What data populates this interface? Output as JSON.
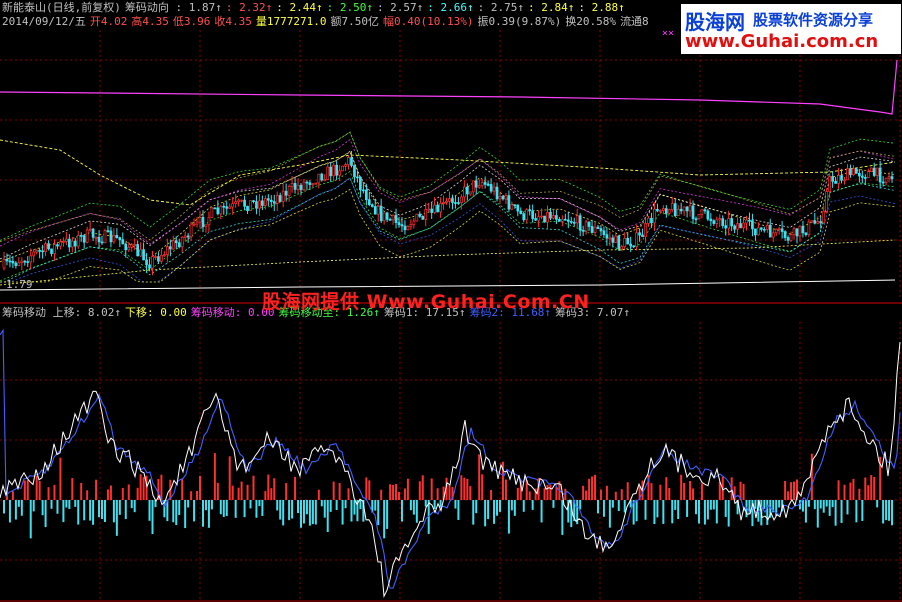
{
  "header": {
    "row1": [
      {
        "text": "新能泰山(日线,前复权)",
        "color": "#c0c0c0"
      },
      {
        "text": "筹码动向 : 1.87↑",
        "color": "#c0c0c0"
      },
      {
        "text": ": 2.32↑",
        "color": "#ff5050"
      },
      {
        "text": ": 2.44↑",
        "color": "#ffff40"
      },
      {
        "text": ": 2.50↑",
        "color": "#40ff40"
      },
      {
        "text": ": 2.57↑",
        "color": "#c0c0c0"
      },
      {
        "text": ": 2.66↑",
        "color": "#40ffff"
      },
      {
        "text": ": 2.75↑",
        "color": "#c0c0c0"
      },
      {
        "text": ": 2.84↑",
        "color": "#ffff40"
      },
      {
        "text": ": 2.88↑",
        "color": "#ffff40"
      }
    ],
    "row2": [
      {
        "text": "2014/09/12/五",
        "color": "#c0c0c0"
      },
      {
        "text": "开4.02",
        "color": "#ff5050"
      },
      {
        "text": "高4.35",
        "color": "#ff5050"
      },
      {
        "text": "低3.96",
        "color": "#ff5050"
      },
      {
        "text": "收4.35",
        "color": "#ff5050"
      },
      {
        "text": "量1777271.0",
        "color": "#ffff40"
      },
      {
        "text": "额7.50亿",
        "color": "#c0c0c0"
      },
      {
        "text": "幅0.40(10.13%)",
        "color": "#ff5050"
      },
      {
        "text": "振0.39(9.87%)",
        "color": "#c0c0c0"
      },
      {
        "text": "换20.58%",
        "color": "#c0c0c0"
      },
      {
        "text": "流通8",
        "color": "#c0c0c0"
      }
    ],
    "row3": [
      {
        "text": "筹码移动 上移: 8.02↑",
        "color": "#c0c0c0"
      },
      {
        "text": "下移: 0.00",
        "color": "#ffff40"
      },
      {
        "text": "筹码移动: 0.00",
        "color": "#ff40ff"
      },
      {
        "text": "筹码移动至: 1.26↑",
        "color": "#40ff40"
      },
      {
        "text": "筹码1: 17.15↑",
        "color": "#c0c0c0"
      },
      {
        "text": "筹码2: 11.68↑",
        "color": "#4060ff"
      },
      {
        "text": "筹码3: 7.07↑",
        "color": "#c0c0c0"
      }
    ]
  },
  "watermark_center": "股海网提供 Www.Guhai.Com.CN",
  "logo": {
    "brand": "股海网",
    "tagline": "股票软件资源分享",
    "url": "www.Guhai.com.cn"
  },
  "min_label": "1.79",
  "x_mark": "××",
  "colors": {
    "up": "#ff3030",
    "down": "#40e0f0",
    "grid": "#8a0000",
    "divider": "#b00000"
  },
  "chart_data": [
    {
      "type": "line",
      "panel": "price",
      "title": "",
      "series_count": 9,
      "min_label": 1.79,
      "legend": [
        1.87,
        2.32,
        2.44,
        2.5,
        2.57,
        2.66,
        2.75,
        2.84,
        2.88
      ],
      "last_bar": {
        "open": 4.02,
        "high": 4.35,
        "low": 3.96,
        "close": 4.35,
        "date": "2014/09/12"
      }
    },
    {
      "type": "bar",
      "panel": "indicator",
      "title": "",
      "values": {
        "上移": 8.02,
        "下移": 0.0,
        "筹码移动": 0.0,
        "筹码移动至": 1.26,
        "筹码1": 17.15,
        "筹码2": 11.68,
        "筹码3": 7.07
      }
    }
  ]
}
